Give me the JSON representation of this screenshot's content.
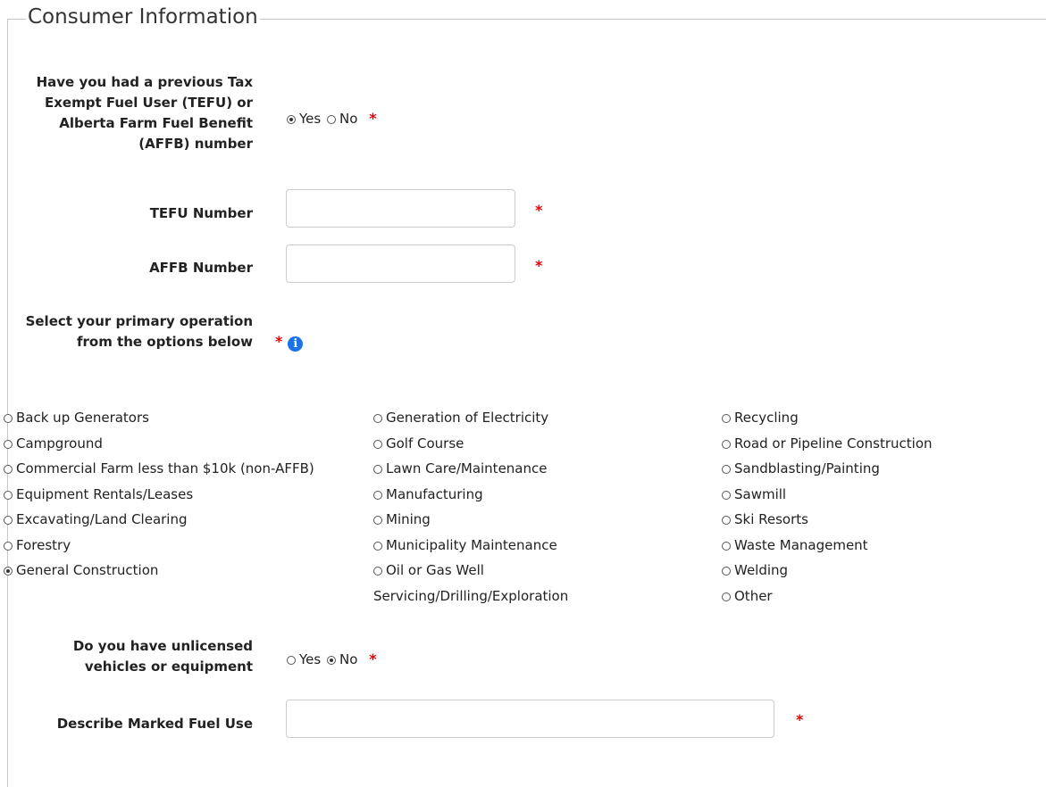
{
  "section": {
    "title": "Consumer Information"
  },
  "q_previous": {
    "label": "Have you had a previous Tax Exempt Fuel User (TEFU) or Alberta Farm Fuel Benefit (AFFB) number",
    "options": [
      "Yes",
      "No"
    ],
    "selected": "Yes",
    "required_mark": "*"
  },
  "tefu": {
    "label": "TEFU Number",
    "value": "",
    "required_mark": "*"
  },
  "affb": {
    "label": "AFFB Number",
    "value": "",
    "required_mark": "*"
  },
  "primary_op": {
    "label": "Select your primary operation from the options below",
    "required_mark": "*",
    "info_icon": "info-icon",
    "selected": "General Construction",
    "col1": [
      "Back up Generators",
      "Campground",
      "Commercial Farm less than $10k (non-AFFB)",
      "Equipment Rentals/Leases",
      "Excavating/Land Clearing",
      "Forestry",
      "General Construction"
    ],
    "col2": [
      "Generation of Electricity",
      "Golf Course",
      "Lawn Care/Maintenance",
      "Manufacturing",
      "Mining",
      "Municipality Maintenance",
      "Oil or Gas Well Servicing/Drilling/Exploration"
    ],
    "col3": [
      "Recycling",
      "Road or Pipeline Construction",
      "Sandblasting/Painting",
      "Sawmill",
      "Ski Resorts",
      "Waste Management",
      "Welding",
      "Other"
    ]
  },
  "q_unlicensed": {
    "label": "Do you have unlicensed vehicles or equipment",
    "options": [
      "Yes",
      "No"
    ],
    "selected": "No",
    "required_mark": "*"
  },
  "marked_fuel": {
    "label": "Describe Marked Fuel Use",
    "value": "",
    "required_mark": "*"
  }
}
